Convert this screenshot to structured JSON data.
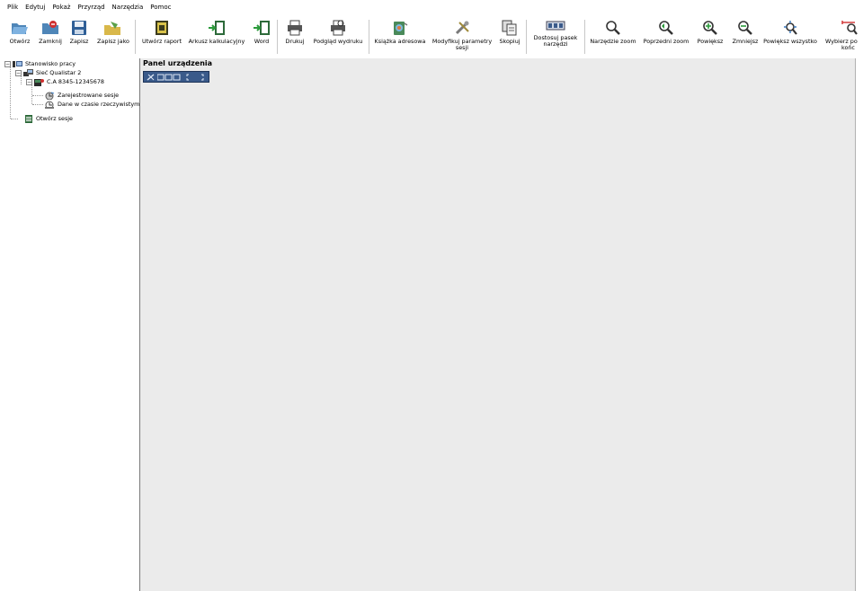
{
  "menu": [
    "Plik",
    "Edytuj",
    "Pokaż",
    "Przyrząd",
    "Narzędzia",
    "Pomoc"
  ],
  "toolbar": {
    "open": "Otwórz",
    "close": "Zamknij",
    "save": "Zapisz",
    "save_as": "Zapisz jako",
    "create_report": "Utwórz raport",
    "spreadsheet": "Arkusz kalkulacyjny",
    "word": "Word",
    "print": "Drukuj",
    "print_preview": "Podgląd wydruku",
    "address_book": "Książka adresowa",
    "modify_params_1": "Modyfikuj parametry",
    "modify_params_2": "sesji",
    "copy": "Skopiuj",
    "customize_1": "Dostosuj pasek",
    "customize_2": "narzędzi",
    "zoom_tool": "Narzędzie zoom",
    "prev_zoom": "Poprzedni zoom",
    "zoom_in": "Powiększ",
    "zoom_out": "Zmniejsz",
    "zoom_all": "Powiększ wszystko",
    "select_1": "Wybierz po",
    "select_2": "końc"
  },
  "tree": {
    "workstation": "Stanowisko pracy",
    "network": "Sieć Qualistar 2",
    "device": "C.A 8345-12345678",
    "recorded": "Zarejestrowane sesje",
    "realtime": "Dane w czasie rzeczywistym",
    "open_sessions": "Otwórz sesje"
  },
  "panel": {
    "title": "Panel urządzenia"
  }
}
